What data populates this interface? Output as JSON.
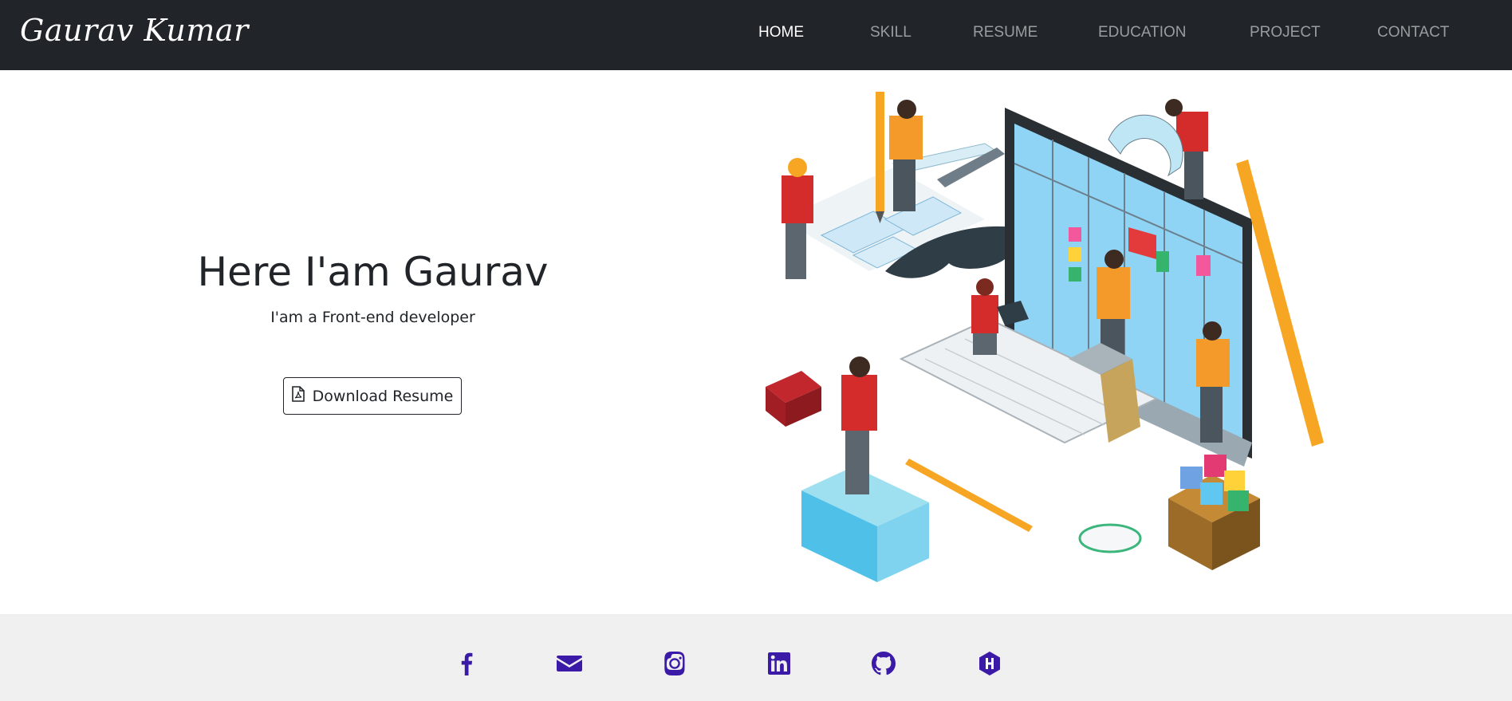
{
  "brand": "Gaurav Kumar",
  "nav": {
    "items": [
      "HOME",
      "SKILL",
      "RESUME",
      "EDUCATION",
      "PROJECT",
      "CONTACT"
    ],
    "active": "HOME"
  },
  "hero": {
    "title": "Here I'am Gaurav",
    "subtitle": "I'am a Front-end developer",
    "button_label": "Download Resume"
  },
  "social_icons": [
    "facebook-icon",
    "email-icon",
    "instagram-icon",
    "linkedin-icon",
    "github-icon",
    "hashnode-icon"
  ],
  "colors": {
    "navbar_bg": "#212529",
    "nav_active": "#ffffff",
    "nav_inactive": "#9a9da0",
    "footer_bg": "#f0f0f0",
    "social_icon": "#3a1aa6"
  }
}
